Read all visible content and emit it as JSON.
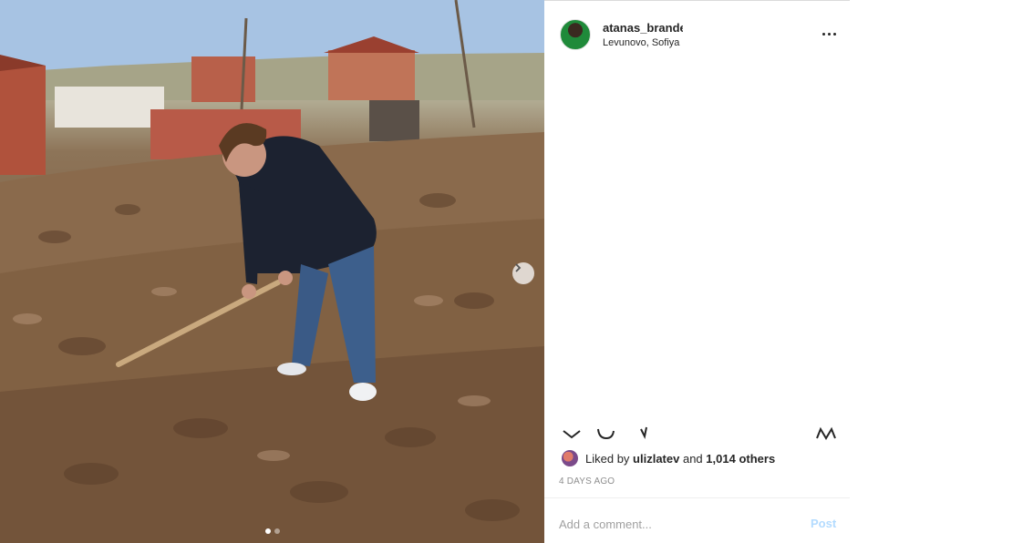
{
  "post": {
    "username": "atanas_brande",
    "location": "Levunovo, Sofiya"
  },
  "likes": {
    "prefix": "Liked by",
    "liker": "ulizlatev",
    "joiner": "and",
    "others": "1,014 others"
  },
  "timestamp": "4 DAYS AGO",
  "comment": {
    "placeholder": "Add a comment...",
    "post_label": "Post"
  },
  "carousel": {
    "total": 2,
    "active_index": 1
  },
  "icons": {
    "more": "more-options-icon",
    "next": "chevron-right-icon",
    "like": "heart-icon",
    "comment": "comment-icon",
    "share": "share-icon",
    "save": "bookmark-icon"
  },
  "colors": {
    "accent_disabled": "#b3dbff",
    "text": "#262626",
    "muted": "#8e8e8e"
  }
}
